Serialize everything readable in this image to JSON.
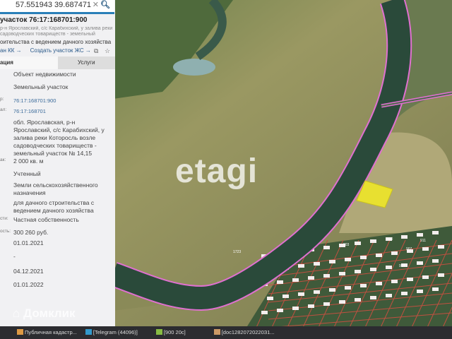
{
  "search": {
    "value": "57.551943 39.687471",
    "clear_icon": "close-icon",
    "search_icon": "magnifier-icon"
  },
  "header": {
    "title": "участок 76:17:168701:900",
    "address_short": "р-н Ярославский, с/с Карабихский, у залива реки садоводческих товариществ - земельный участок №...",
    "purpose": "оительства с ведением дачного хозяйства",
    "link1": "ан КК →",
    "link2": "Создать участок ЖС →"
  },
  "tabs": [
    {
      "label": "ация"
    },
    {
      "label": "Услуги"
    }
  ],
  "rows": [
    {
      "label": "",
      "value": "Объект недвижимости"
    },
    {
      "label": "",
      "value": "Земельный участок"
    },
    {
      "label": "р:",
      "value": "76:17:168701:900"
    },
    {
      "label": "ал:",
      "value": "76:17:168701"
    },
    {
      "label": "",
      "value": "обл. Ярославская, р-н Ярославский, с/с Карабихский, у залива реки Которосль возле садоводческих товариществ - земельный участок № 14,15"
    },
    {
      "label": "ак:",
      "value": "2 000 кв. м"
    },
    {
      "label": "",
      "value": "Учтенный"
    },
    {
      "label": "",
      "value": "Земли сельскохозяйственного назначения"
    },
    {
      "label": "",
      "value": "для дачного строительства с ведением дачного хозяйства"
    },
    {
      "label": "сти:",
      "value": "Частная собственность"
    },
    {
      "label": "ость:",
      "value": "300 260 руб."
    },
    {
      "label": "",
      "value": "01.01.2021"
    },
    {
      "label": "",
      "value": "-"
    },
    {
      "label": "",
      "value": "04.12.2021"
    },
    {
      "label": "",
      "value": "01.01.2022"
    }
  ],
  "watermarks": {
    "domclick": "Домклик",
    "etagi": "etagi"
  },
  "map": {
    "parcel_color": "#e8e030",
    "boundary_color": "#e070d0",
    "river_color": "#2a4a3a",
    "lot_labels": [
      "1723",
      "903",
      "920",
      "907",
      "911",
      "914"
    ]
  },
  "taskbar": [
    {
      "label": "Публичная кадастр..."
    },
    {
      "label": "[Telegram (44096)]"
    },
    {
      "label": "[900 20с]"
    },
    {
      "label": "[doc12820720220З1..."
    }
  ]
}
